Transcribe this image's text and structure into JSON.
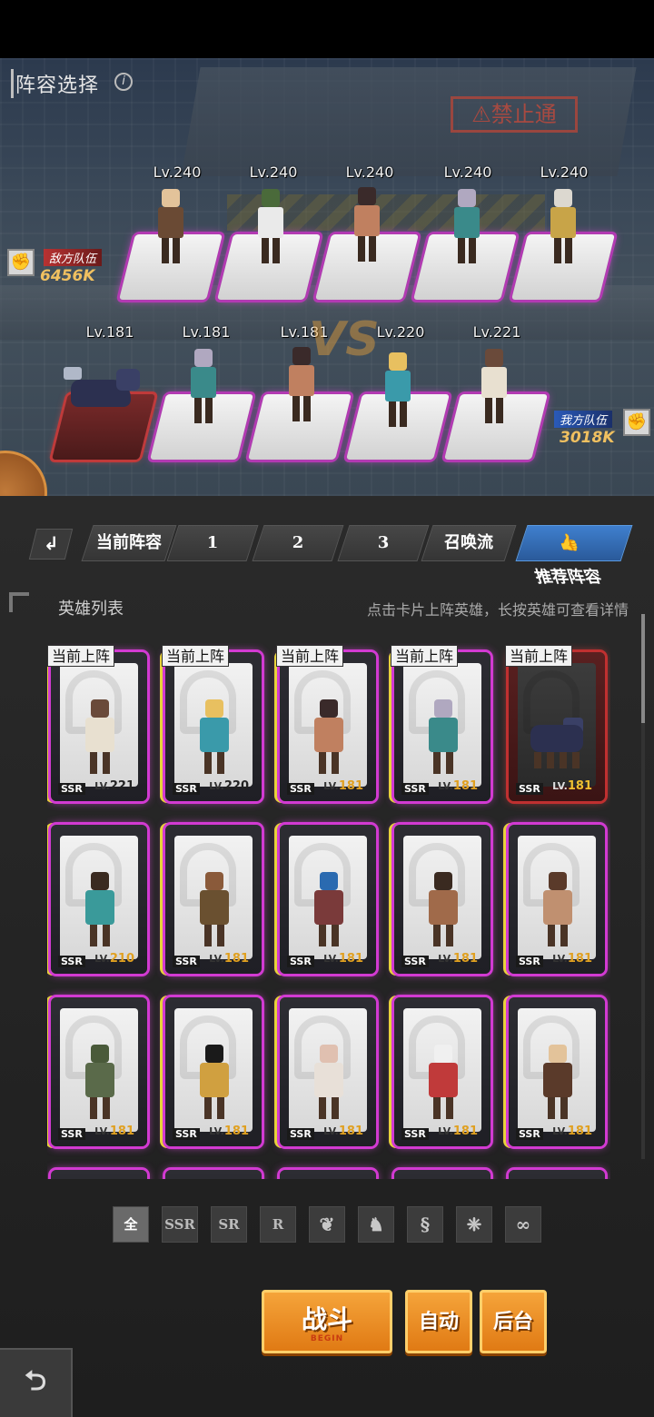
{
  "scene": {
    "title": "阵容选择",
    "info_icon": "i",
    "forbidden_sign": "⚠禁止通",
    "enemy_team": {
      "name": "敌方队伍",
      "power": "6456K",
      "levels": [
        "Lv.240",
        "Lv.240",
        "Lv.240",
        "Lv.240",
        "Lv.240"
      ]
    },
    "ally_team": {
      "name": "我方队伍",
      "power": "3018K",
      "levels": [
        "Lv.181",
        "Lv.181",
        "Lv.181",
        "Lv.220",
        "Lv.221"
      ]
    },
    "vs": "VS"
  },
  "tabs": {
    "back_icon": "↲",
    "items": [
      {
        "label": "当前阵容"
      },
      {
        "label": "1"
      },
      {
        "label": "2"
      },
      {
        "label": "3"
      },
      {
        "label": "召唤流"
      },
      {
        "label": "推荐阵容",
        "icon": "thumbs-up-icon"
      }
    ]
  },
  "hero_list": {
    "title": "英雄列表",
    "hint": "点击卡片上阵英雄，长按英雄可查看详情",
    "deployed_tag": "当前上阵",
    "cards": [
      {
        "rarity": "SSR",
        "lv_prefix": "LV.",
        "lv": "221",
        "deployed": true
      },
      {
        "rarity": "SSR",
        "lv_prefix": "LV.",
        "lv": "220",
        "deployed": true
      },
      {
        "rarity": "SSR",
        "lv_prefix": "LV.",
        "lv": "181",
        "deployed": true
      },
      {
        "rarity": "SSR",
        "lv_prefix": "LV.",
        "lv": "181",
        "deployed": true
      },
      {
        "rarity": "SSR",
        "lv_prefix": "LV.",
        "lv": "181",
        "deployed": true
      },
      {
        "rarity": "SSR",
        "lv_prefix": "LV.",
        "lv": "210",
        "deployed": false
      },
      {
        "rarity": "SSR",
        "lv_prefix": "LV.",
        "lv": "181",
        "deployed": false
      },
      {
        "rarity": "SSR",
        "lv_prefix": "LV.",
        "lv": "181",
        "deployed": false
      },
      {
        "rarity": "SSR",
        "lv_prefix": "LV.",
        "lv": "181",
        "deployed": false
      },
      {
        "rarity": "SSR",
        "lv_prefix": "LV.",
        "lv": "181",
        "deployed": false
      },
      {
        "rarity": "SSR",
        "lv_prefix": "LV.",
        "lv": "181",
        "deployed": false
      },
      {
        "rarity": "SSR",
        "lv_prefix": "LV.",
        "lv": "181",
        "deployed": false
      },
      {
        "rarity": "SSR",
        "lv_prefix": "LV.",
        "lv": "181",
        "deployed": false
      },
      {
        "rarity": "SSR",
        "lv_prefix": "LV.",
        "lv": "181",
        "deployed": false
      },
      {
        "rarity": "SSR",
        "lv_prefix": "LV.",
        "lv": "181",
        "deployed": false
      }
    ]
  },
  "filters": {
    "items": [
      {
        "label": "全",
        "active": true
      },
      {
        "label": "SSR"
      },
      {
        "label": "SR"
      },
      {
        "label": "R"
      },
      {
        "label": "",
        "icon": "faction-eagle-icon"
      },
      {
        "label": "",
        "icon": "faction-wolf-icon"
      },
      {
        "label": "",
        "icon": "faction-dragon-icon"
      },
      {
        "label": "",
        "icon": "faction-wing-icon"
      },
      {
        "label": "",
        "icon": "faction-infinity-icon"
      }
    ]
  },
  "actions": {
    "fight": "战斗",
    "fight_sub": "BEGIN",
    "auto": "自动",
    "background": "后台",
    "back_icon": "⮌"
  },
  "colors": {
    "accent_orange": "#f5a43a",
    "card_glow": "#d23ad2",
    "recommend_blue": "#3f7fce",
    "enemy_red": "#b83232",
    "ally_blue": "#2a5ab8"
  }
}
